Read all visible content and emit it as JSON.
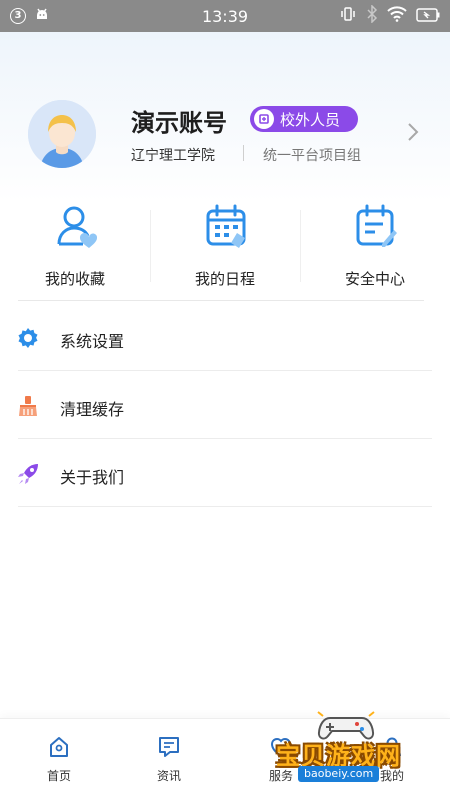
{
  "status_bar": {
    "notification_count": "3",
    "time": "13:39",
    "icons": [
      "android-icon",
      "vibrate-icon",
      "bluetooth-icon",
      "wifi-icon",
      "battery-icon"
    ]
  },
  "profile": {
    "name": "演示账号",
    "role_badge": "校外人员",
    "school": "辽宁理工学院",
    "department": "统一平台项目组"
  },
  "quick_links": [
    {
      "label": "我的收藏",
      "icon": "user-heart-icon"
    },
    {
      "label": "我的日程",
      "icon": "calendar-icon"
    },
    {
      "label": "安全中心",
      "icon": "calendar-edit-icon"
    }
  ],
  "menu": [
    {
      "label": "系统设置",
      "icon": "gear-icon",
      "color": "#2c8ee8"
    },
    {
      "label": "清理缓存",
      "icon": "broom-icon",
      "color": "#f07a4a"
    },
    {
      "label": "关于我们",
      "icon": "rocket-icon",
      "color": "#8b4ae8"
    }
  ],
  "tabs": [
    {
      "label": "首页",
      "icon": "home-icon"
    },
    {
      "label": "资讯",
      "icon": "message-icon"
    },
    {
      "label": "服务",
      "icon": "service-icon"
    },
    {
      "label": "我的",
      "icon": "user-icon"
    }
  ],
  "watermark": {
    "text": "宝贝游戏网",
    "url": "baobeiy.com"
  },
  "colors": {
    "accent_blue": "#2c8ee8",
    "badge_purple": "#8b4ae8",
    "status_bar": "#8a8a8a"
  }
}
